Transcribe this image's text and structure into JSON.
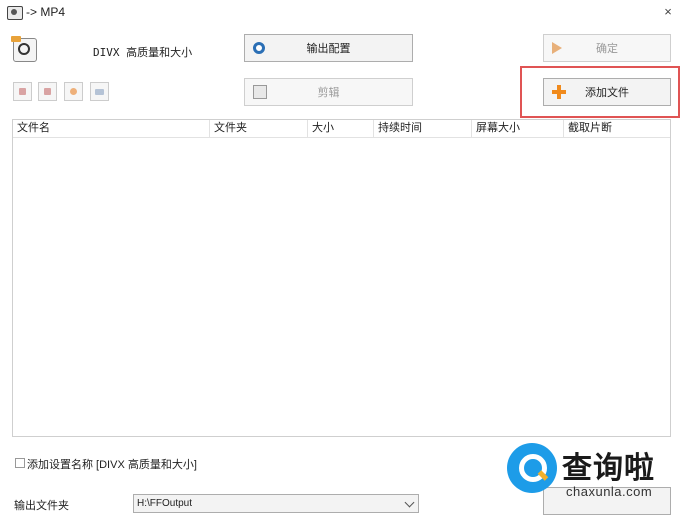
{
  "window": {
    "title": "-> MP4",
    "close_glyph": "×"
  },
  "format": {
    "label": "DIVX 高质量和大小",
    "icon": "video-format-icon"
  },
  "buttons": {
    "output_config": "输出配置",
    "ok": "确定",
    "cut": "剪辑",
    "add_file": "添加文件"
  },
  "toolbar_icons": [
    "remove-file-icon",
    "clear-list-icon",
    "play-icon",
    "image-icon"
  ],
  "table": {
    "columns": [
      "文件名",
      "文件夹",
      "大小",
      "持续时间",
      "屏幕大小",
      "截取片断"
    ]
  },
  "options": {
    "add_setting_name": "添加设置名称 [DIVX 高质量和大小]",
    "add_setting_name_checked": false
  },
  "output": {
    "label": "输出文件夹",
    "folder": "H:\\FFOutput"
  },
  "watermark": {
    "cn": "查询啦",
    "en": "chaxunla.com"
  },
  "colors": {
    "highlight": "#e05454",
    "accent": "#2b6fb5",
    "add_icon": "#f08a1c",
    "watermark_blue": "#1d9ce8"
  }
}
